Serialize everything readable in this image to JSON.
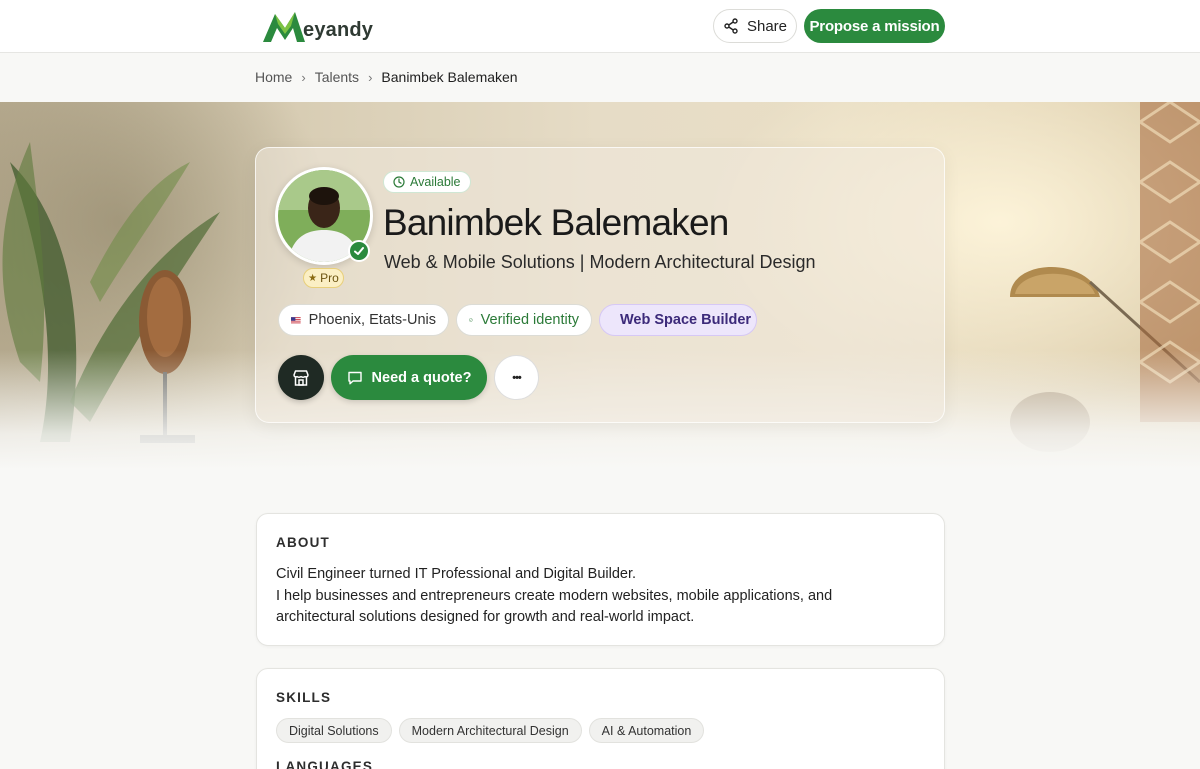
{
  "header": {
    "logo_text": "eyandy",
    "share_label": "Share",
    "propose_label": "Propose a mission"
  },
  "breadcrumb": {
    "items": [
      "Home",
      "Talents",
      "Banimbek Balemaken"
    ]
  },
  "profile": {
    "availability": "Available",
    "name": "Banimbek Balemaken",
    "tagline": "Web & Mobile Solutions | Modern Architectural Design",
    "badge": "Pro",
    "chips": {
      "location": "Phoenix, Etats-Unis",
      "verified": "Verified identity",
      "builder": "Web Space Builder"
    },
    "actions": {
      "quote_label": "Need a quote?",
      "more_label": "•••"
    }
  },
  "about": {
    "title": "ABOUT",
    "lines": [
      "Civil Engineer turned IT Professional and Digital Builder.",
      "I help businesses and entrepreneurs create modern websites, mobile applications, and architectural solutions designed for growth and real-world impact."
    ]
  },
  "skills": {
    "title": "SKILLS",
    "tags": [
      "Digital Solutions",
      "Modern Architectural Design",
      "AI & Automation"
    ]
  },
  "languages": {
    "title": "LANGUAGES"
  },
  "colors": {
    "brand_green": "#2b8a3e",
    "builder_purple": "#ede6fb",
    "pro_gold": "#fbefc4"
  }
}
